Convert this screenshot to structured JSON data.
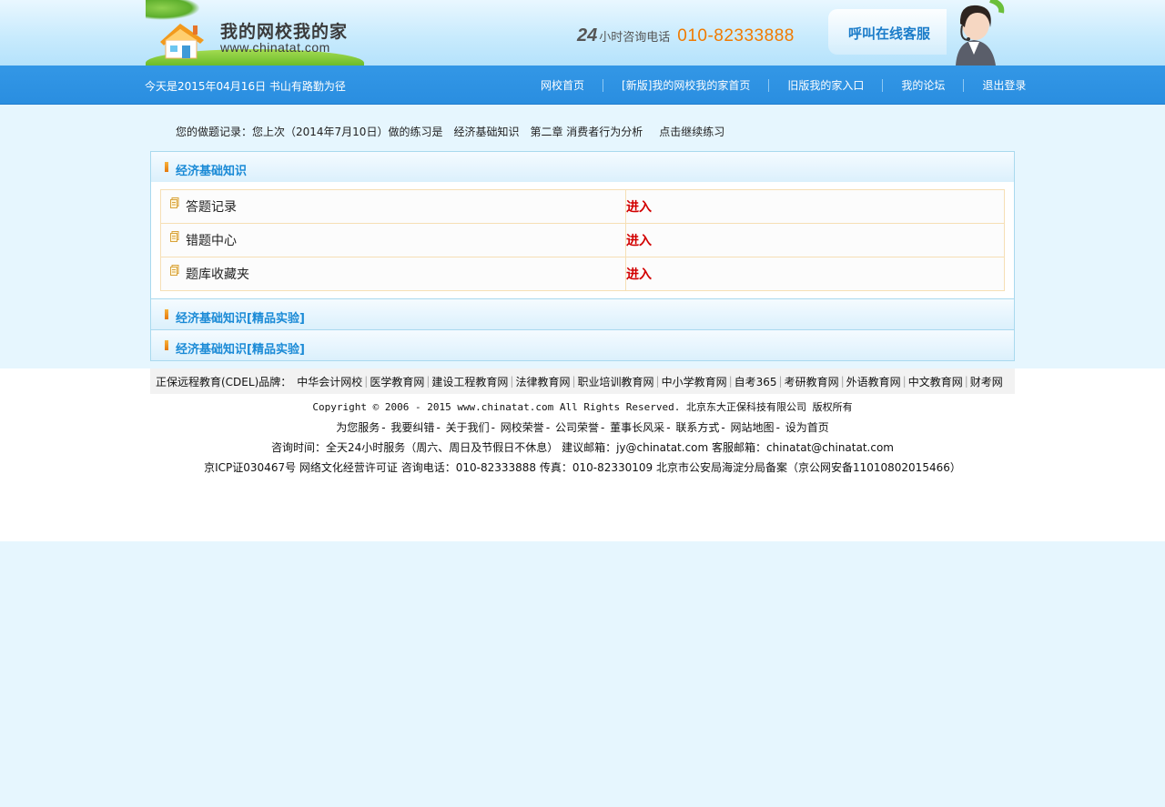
{
  "header": {
    "logo_title": "我的网校我的家",
    "logo_url": "www.chinatat.com",
    "hotline_24": "24",
    "hotline_label": "小时咨询电话",
    "hotline_phone": "010-82333888",
    "service_label": "呼叫在线客服"
  },
  "nav": {
    "date_text": "今天是2015年04月16日  书山有路勤为径",
    "links": [
      "网校首页",
      "[新版]我的网校我的家首页",
      "旧版我的家入口",
      "我的论坛",
      "退出登录"
    ]
  },
  "record": {
    "prefix": "您的做题记录：您上次（2014年7月10日）做的练习是",
    "subject": "经济基础知识",
    "chapter": "第二章 消费者行为分析",
    "continue_label": "点击继续练习"
  },
  "panels": [
    {
      "title": "经济基础知识",
      "items": [
        {
          "name": "答题记录",
          "action": "进入"
        },
        {
          "name": "错题中心",
          "action": "进入"
        },
        {
          "name": "题库收藏夹",
          "action": "进入"
        }
      ]
    },
    {
      "title": "经济基础知识[精品实验]"
    },
    {
      "title": "经济基础知识[精品实验]"
    }
  ],
  "footer": {
    "brands_label": "正保远程教育(CDEL)品牌：",
    "brands": [
      "中华会计网校",
      "医学教育网",
      "建设工程教育网",
      "法律教育网",
      "职业培训教育网",
      "中小学教育网",
      "自考365",
      "考研教育网",
      "外语教育网",
      "中文教育网",
      "财考网"
    ],
    "copyright": "Copyright © 2006 - 2015 www.chinatat.com All Rights Reserved.  北京东大正保科技有限公司 版权所有",
    "service_links": [
      "为您服务",
      "我要纠错",
      "关于我们",
      "网校荣誉",
      "公司荣誉",
      "董事长风采",
      "联系方式",
      "网站地图",
      "设为首页"
    ],
    "contact": "咨询时间：全天24小时服务（周六、周日及节假日不休息） 建议邮箱：jy@chinatat.com 客服邮箱：chinatat@chinatat.com",
    "icp": "京ICP证030467号  网络文化经营许可证  咨询电话：010-82333888 传真：010-82330109  北京市公安局海淀分局备案（京公网安备11010802015466）"
  },
  "colors": {
    "nav_bg": "#2a8ee0",
    "panel_title": "#1a8ad6",
    "enter_red": "#d20000",
    "hotline_orange": "#f07a00"
  }
}
